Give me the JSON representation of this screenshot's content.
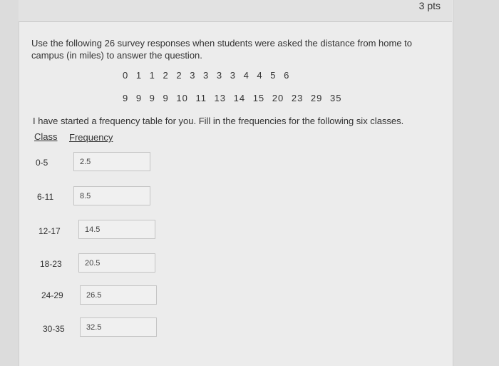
{
  "header": {
    "points": "3 pts"
  },
  "question": {
    "intro": "Use the following 26 survey responses when students were asked the distance from home to campus (in miles) to answer the question.",
    "data_row1": "0 1 1 2 2 3 3 3 3 4 4 5 6",
    "data_row2": "9 9 9 9 10 11 13 14 15 20 23 29 35",
    "instruction": "I have started a frequency table for you.  Fill in the frequencies for the following six classes."
  },
  "table": {
    "class_header": "Class",
    "frequency_header": "Frequency",
    "rows": [
      {
        "class": "0-5",
        "value": "2.5"
      },
      {
        "class": "6-11",
        "value": "8.5"
      },
      {
        "class": "12-17",
        "value": "14.5"
      },
      {
        "class": "18-23",
        "value": "20.5"
      },
      {
        "class": "24-29",
        "value": "26.5"
      },
      {
        "class": "30-35",
        "value": "32.5"
      }
    ]
  }
}
